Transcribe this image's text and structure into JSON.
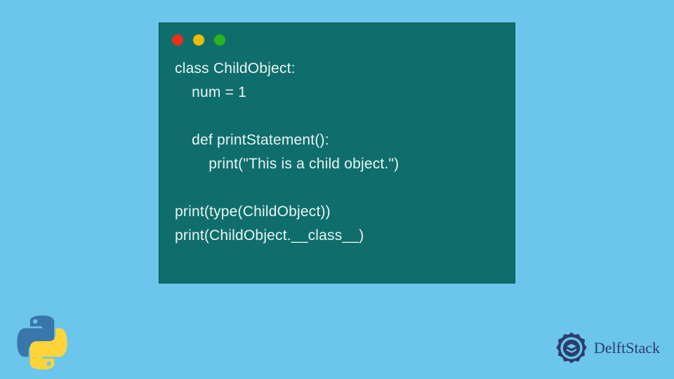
{
  "colors": {
    "background": "#6cc5eb",
    "window_bg": "#0f6e6c",
    "code_text": "#e8f5f4",
    "dot_red": "#ed2e15",
    "dot_yellow": "#f2ba00",
    "dot_green": "#27b41d",
    "delft_text": "#2a3d6f"
  },
  "code": {
    "line1": "class ChildObject:",
    "line2": "    num = 1",
    "line3": "",
    "line4": "    def printStatement():",
    "line5": "        print(\"This is a child object.\")",
    "line6": "",
    "line7": "print(type(ChildObject))",
    "line8": "print(ChildObject.__class__)"
  },
  "brand": {
    "name": "DelftStack"
  },
  "icons": {
    "python": "python-logo",
    "delft": "delft-gear-icon"
  }
}
